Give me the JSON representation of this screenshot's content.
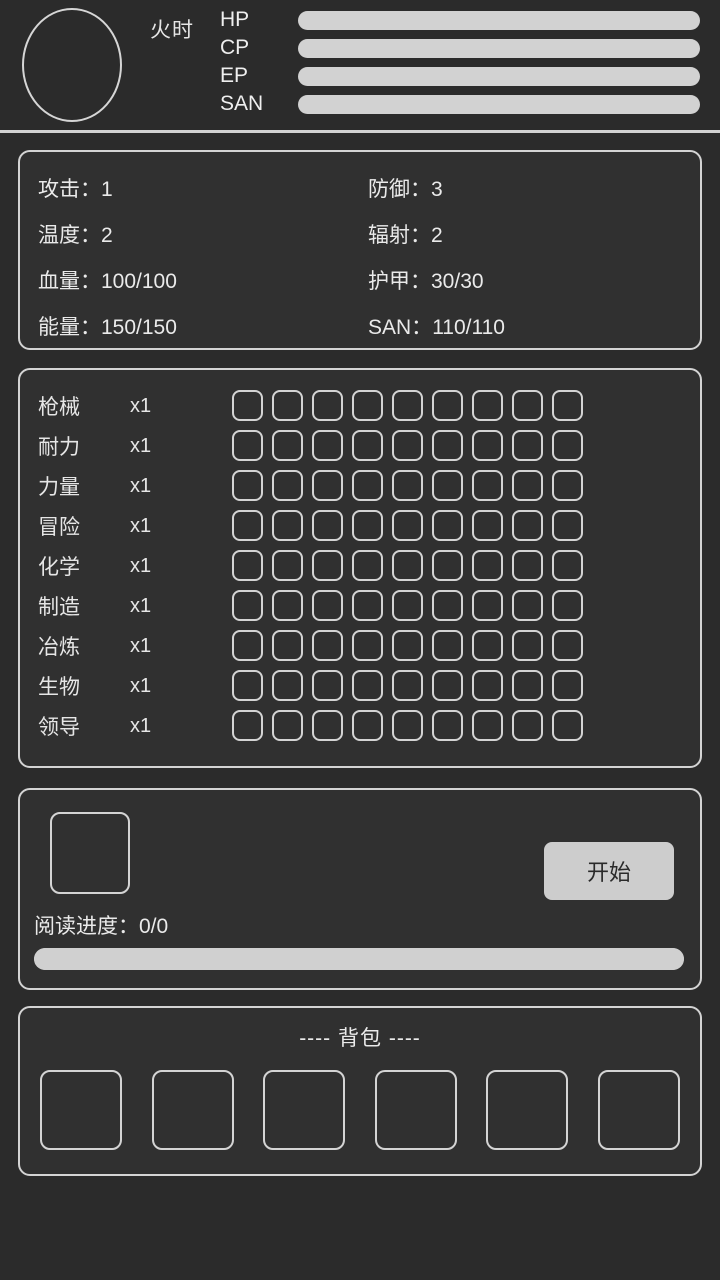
{
  "header": {
    "character_name": "火时",
    "avatar_icon": "avatar-circle-icon",
    "bars": [
      {
        "label": "HP",
        "fill_percent": 100
      },
      {
        "label": "CP",
        "fill_percent": 100
      },
      {
        "label": "EP",
        "fill_percent": 100
      },
      {
        "label": "SAN",
        "fill_percent": 100
      }
    ]
  },
  "stats": {
    "items": [
      {
        "key": "攻击：",
        "value": "1"
      },
      {
        "key": "防御：",
        "value": "3"
      },
      {
        "key": "温度：",
        "value": "2"
      },
      {
        "key": "辐射：",
        "value": "2"
      },
      {
        "key": "血量：",
        "value": "100/100"
      },
      {
        "key": "护甲：",
        "value": "30/30"
      },
      {
        "key": "能量：",
        "value": "150/150"
      },
      {
        "key": "SAN：",
        "value": "110/110"
      }
    ]
  },
  "skills": {
    "rows": [
      {
        "label": "枪械",
        "count": "x1"
      },
      {
        "label": "耐力",
        "count": "x1"
      },
      {
        "label": "力量",
        "count": "x1"
      },
      {
        "label": "冒险",
        "count": "x1"
      },
      {
        "label": "化学",
        "count": "x1"
      },
      {
        "label": "制造",
        "count": "x1"
      },
      {
        "label": "冶炼",
        "count": "x1"
      },
      {
        "label": "生物",
        "count": "x1"
      },
      {
        "label": "领导",
        "count": "x1"
      }
    ],
    "grid_columns": 9,
    "grid_rows": 9
  },
  "reading": {
    "book_slot_label": "book-cover-slot",
    "start_label": "开始",
    "progress_label": "阅读进度：0/0",
    "progress_percent": 100
  },
  "backpack": {
    "title": "---- 背包 ----",
    "slot_count": 6
  },
  "colors": {
    "background": "#2b2b2b",
    "panel": "#303030",
    "outline": "#d4d4d4",
    "bar": "#d2d2d2",
    "button": "#cdcdcd",
    "text": "#eaeaea"
  }
}
